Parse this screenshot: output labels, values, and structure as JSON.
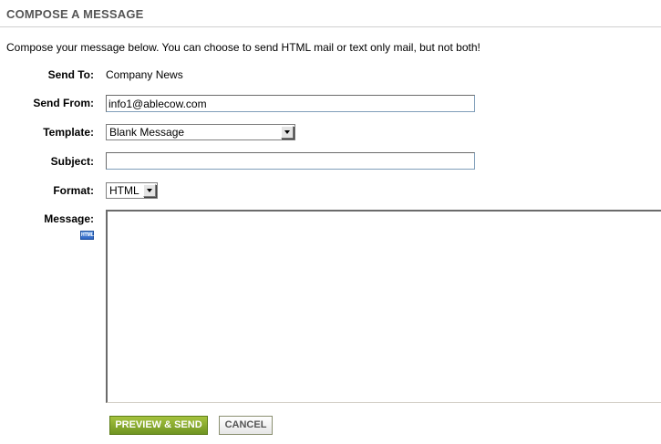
{
  "page": {
    "title": "COMPOSE A MESSAGE",
    "intro": "Compose your message below. You can choose to send HTML mail or text only mail, but not both!"
  },
  "form": {
    "send_to": {
      "label": "Send To:",
      "value": "Company News"
    },
    "send_from": {
      "label": "Send From:",
      "value": "info1@ablecow.com"
    },
    "template": {
      "label": "Template:",
      "selected": "Blank Message"
    },
    "subject": {
      "label": "Subject:",
      "value": ""
    },
    "format": {
      "label": "Format:",
      "selected": "HTML"
    },
    "message": {
      "label": "Message:",
      "value": "",
      "editor_icon": "HTML"
    }
  },
  "buttons": {
    "preview_send": "PREVIEW & SEND",
    "cancel": "CANCEL"
  },
  "colors": {
    "title": "#555555",
    "preview_button": "#8aab2f",
    "cancel_border": "#8a8f70"
  },
  "icons": {
    "html_editor": "html-editor-icon",
    "dropdown": "chevron-down-icon"
  }
}
